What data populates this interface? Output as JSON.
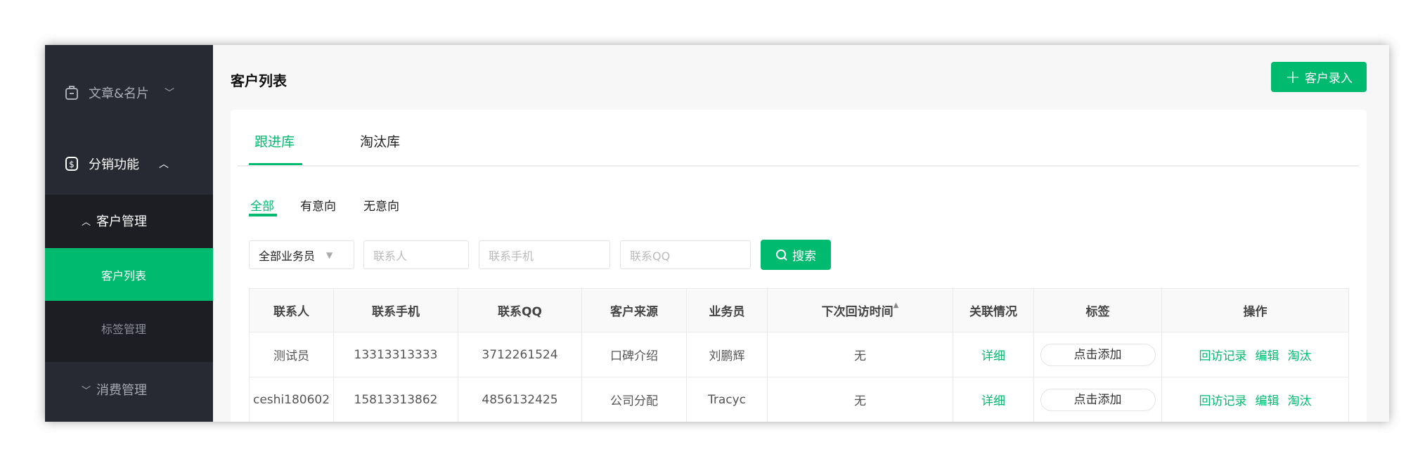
{
  "sidebar": {
    "items": [
      {
        "label": "文章&名片",
        "icon": "briefcase-icon",
        "chevron": "down"
      },
      {
        "label": "分销功能",
        "icon": "dollar-icon",
        "chevron": "up"
      },
      {
        "label": "客户管理",
        "chevron": "up"
      },
      {
        "label": "客户列表",
        "active": true
      },
      {
        "label": "标签管理"
      },
      {
        "label": "消费管理",
        "chevron": "down"
      }
    ]
  },
  "header": {
    "title": "客户列表",
    "add_button": "客户录入"
  },
  "tabs": [
    {
      "label": "跟进库",
      "active": true
    },
    {
      "label": "淘汰库"
    }
  ],
  "subtabs": [
    {
      "label": "全部",
      "active": true
    },
    {
      "label": "有意向"
    },
    {
      "label": "无意向"
    }
  ],
  "filters": {
    "salesperson_select": "全部业务员",
    "contact_placeholder": "联系人",
    "phone_placeholder": "联系手机",
    "qq_placeholder": "联系QQ",
    "search_button": "搜索"
  },
  "table": {
    "columns": [
      "联系人",
      "联系手机",
      "联系QQ",
      "客户来源",
      "业务员",
      "下次回访时间",
      "关联情况",
      "标签",
      "操作"
    ],
    "rows": [
      {
        "contact": "测试员",
        "phone": "13313313333",
        "qq": "3712261524",
        "source": "口碑介绍",
        "sales": "刘鹏辉",
        "next_visit": "无",
        "relation": "详细",
        "tag": "点击添加",
        "ops": [
          "回访记录",
          "编辑",
          "淘汰"
        ]
      },
      {
        "contact": "ceshi180602",
        "phone": "15813313862",
        "qq": "4856132425",
        "source": "公司分配",
        "sales": "Tracyc",
        "next_visit": "无",
        "relation": "详细",
        "tag": "点击添加",
        "ops": [
          "回访记录",
          "编辑",
          "淘汰"
        ]
      }
    ]
  },
  "colors": {
    "accent": "#00ba70",
    "sidebar": "#272a32",
    "sidebar_sub": "#1c1e23"
  }
}
